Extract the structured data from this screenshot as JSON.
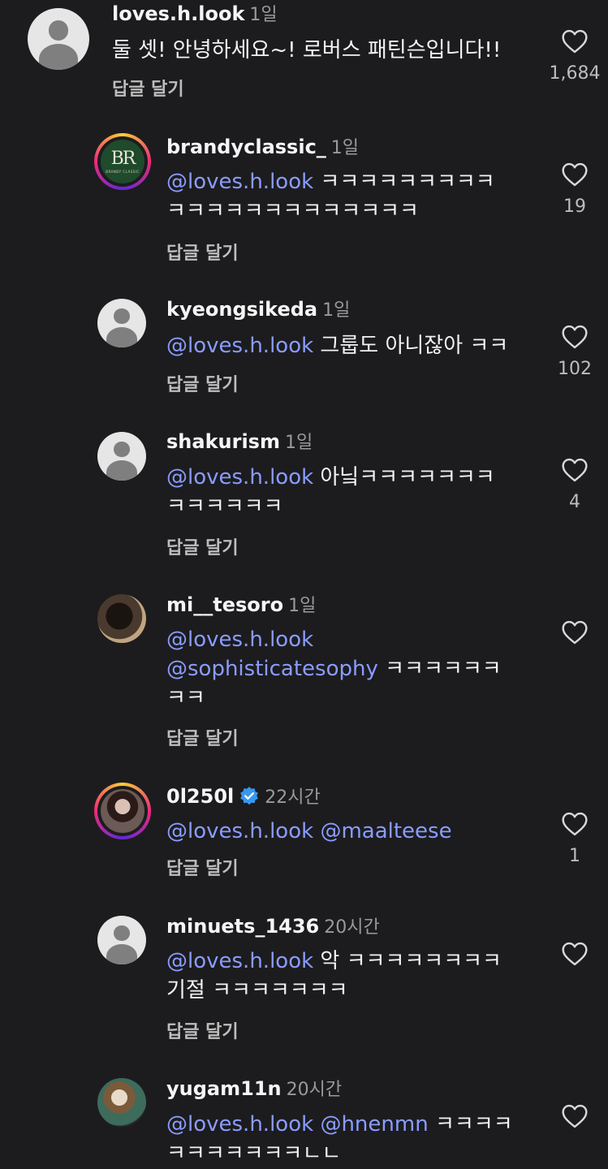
{
  "comments": [
    {
      "username": "loves.h.look",
      "time": "1일",
      "line1": "둘 셋! 안녕하세요~! 로버스 패틴슨입니다!!",
      "reply": "답글 달기",
      "likes": "1,684",
      "avatar": "default-avatar"
    },
    {
      "username": "brandyclassic_",
      "time": "1일",
      "mention": "@loves.h.look",
      "line1": " ㅋㅋㅋㅋㅋㅋㅋㅋㅋ",
      "line2": "ㅋㅋㅋㅋㅋㅋㅋㅋㅋㅋㅋㅋㅋ",
      "reply": "답글 달기",
      "likes": "19",
      "avatar_text": "BR",
      "avatar_sub": "BRANDY CLASSIC"
    },
    {
      "username": "kyeongsikeda",
      "time": "1일",
      "mention": "@loves.h.look",
      "line1": " 그룹도 아니잖아 ㅋㅋ",
      "reply": "답글 달기",
      "likes": "102",
      "avatar": "default-avatar"
    },
    {
      "username": "shakurism",
      "time": "1일",
      "mention": "@loves.h.look",
      "line1": " 아닠ㅋㅋㅋㅋㅋㅋㅋ",
      "line2": "ㅋㅋㅋㅋㅋㅋ",
      "reply": "답글 달기",
      "likes": "4",
      "avatar": "default-avatar"
    },
    {
      "username": "mi__tesoro",
      "time": "1일",
      "mention": "@loves.h.look",
      "mention2": "@sophisticatesophy",
      "line2": " ㅋㅋㅋㅋㅋㅋ",
      "line3": "ㅋㅋ",
      "reply": "답글 달기"
    },
    {
      "username": "0l250l",
      "time": "22시간",
      "mention": "@loves.h.look",
      "mention2": "@maalteese",
      "reply": "답글 달기",
      "likes": "1"
    },
    {
      "username": "minuets_1436",
      "time": "20시간",
      "mention": "@loves.h.look",
      "line1": " 악 ㅋㅋㅋㅋㅋㅋㅋㅋ",
      "line2": "기절 ㅋㅋㅋㅋㅋㅋㅋ",
      "reply": "답글 달기",
      "avatar": "default-avatar"
    },
    {
      "username": "yugam11n",
      "time": "20시간",
      "mention": "@loves.h.look",
      "mention2": "@hnenmn",
      "line1": " ㅋㅋㅋㅋ",
      "line2": "ㅋㅋㅋㅋㅋㅋㅋㄴㄴ"
    }
  ],
  "colors": {
    "background": "#1c1c1e",
    "mention": "#8a9cff",
    "verified": "#3897f0"
  }
}
